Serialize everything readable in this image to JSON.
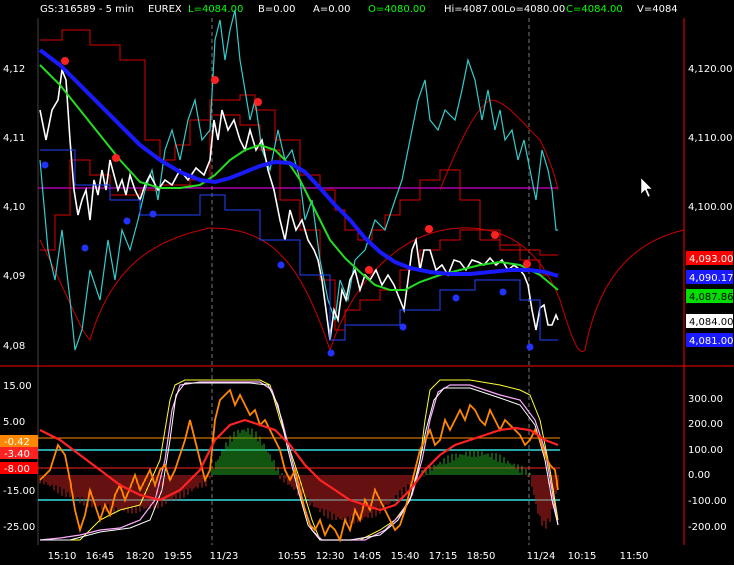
{
  "header": {
    "symbol": "GS:316589 - 5 min",
    "exchange": "EUREX",
    "last": "L=4084.00",
    "bid": "B=0.00",
    "ask": "A=0.00",
    "open": "O=4080.00",
    "high": "Hi=4087.00",
    "low": "Lo=4080.00",
    "close": "C=4084.00",
    "volume": "V=4084"
  },
  "price_tags": [
    {
      "label": "4,093.00",
      "bg": "#ff0000",
      "fg": "#ffffff"
    },
    {
      "label": "4,090.17",
      "bg": "#1a1aff",
      "fg": "#ffffff"
    },
    {
      "label": "4,087.86",
      "bg": "#00dd00",
      "fg": "#000000"
    },
    {
      "label": "4,084.00",
      "bg": "#ffffff",
      "fg": "#000000"
    },
    {
      "label": "4,081.00",
      "bg": "#1a1aff",
      "fg": "#ffffff"
    }
  ],
  "osc_tags": [
    {
      "label": "-0.42",
      "bg": "#ff8800",
      "fg": "#ffffff"
    },
    {
      "label": "-3.40",
      "bg": "#ff2222",
      "fg": "#ffffff"
    },
    {
      "label": "-8.00",
      "bg": "#ff0000",
      "fg": "#ffffff"
    }
  ],
  "chart_data": [
    {
      "type": "line",
      "title": "",
      "yticks_left": [
        "4,12",
        "4,11",
        "4,10",
        "4,09",
        "4,08"
      ],
      "yticks_right": [
        "4,120.00",
        "4,110.00",
        "4,100.00"
      ],
      "ylim": [
        4078,
        4128
      ],
      "xticks": [
        "15:10",
        "16:45",
        "18:20",
        "19:55",
        "11/23",
        "10:55",
        "12:30",
        "14:05",
        "15:40",
        "17:15",
        "18:50",
        "11/24",
        "10:15",
        "11:50"
      ],
      "series": [],
      "price_close": [
        4118,
        4122,
        4112,
        4108,
        4100,
        4098,
        4104,
        4102,
        4106,
        4104,
        4103,
        4104,
        4105,
        4106,
        4112,
        4110,
        4108,
        4104,
        4100,
        4096,
        4092,
        4088,
        4082,
        4086,
        4090,
        4092,
        4088,
        4088,
        4090,
        4092,
        4090,
        4088,
        4090,
        4093,
        4092,
        4090,
        4088,
        4084
      ],
      "ma_blue": [
        4121,
        4119,
        4115,
        4111,
        4107,
        4104,
        4103,
        4103,
        4104,
        4105,
        4106,
        4107,
        4107,
        4106,
        4104,
        4101,
        4098,
        4095,
        4093,
        4092,
        4091,
        4091,
        4091,
        4091,
        4091,
        4090
      ],
      "ma_green": [
        4120,
        4116,
        4110,
        4106,
        4104,
        4103,
        4104,
        4106,
        4108,
        4108,
        4106,
        4102,
        4098,
        4094,
        4091,
        4089,
        4088,
        4088,
        4089,
        4089,
        4088,
        4087
      ],
      "cyan_line": [
        4100,
        4090,
        4080,
        4086,
        4092,
        4098,
        4104,
        4108,
        4110,
        4106,
        4126,
        4120,
        4108,
        4100,
        4094,
        4090,
        4084,
        4080,
        4086,
        4098,
        4110,
        4116,
        4108,
        4114,
        4124,
        4112,
        4108,
        4104,
        4098,
        4096
      ],
      "horizontal_level": 4102.5,
      "dots_red": [
        [
          1,
          4121
        ],
        [
          5,
          4106
        ],
        [
          11,
          4116
        ],
        [
          13,
          4113
        ],
        [
          21,
          4089
        ],
        [
          24,
          4093
        ],
        [
          29,
          4092
        ],
        [
          32,
          4089
        ]
      ],
      "dots_blue": [
        [
          0,
          4105
        ],
        [
          2,
          4093
        ],
        [
          5,
          4099
        ],
        [
          7,
          4100
        ],
        [
          15,
          4091
        ],
        [
          20,
          4080
        ],
        [
          24,
          4085
        ],
        [
          27,
          4087
        ],
        [
          30,
          4088
        ],
        [
          32,
          4081
        ]
      ]
    },
    {
      "type": "line",
      "title": "",
      "yticks_left": [
        "15.00",
        "5.00",
        "-5.00",
        "-15.00",
        "-25.00"
      ],
      "yticks_right": [
        "300.00",
        "200.00",
        "100.00",
        "0.00",
        "-100.00",
        "-200.00"
      ],
      "ylim": [
        -250,
        400
      ],
      "levels": [
        100,
        -100
      ],
      "yellow_osc": [
        -200,
        -220,
        -150,
        -50,
        350,
        370,
        360,
        330,
        300,
        200,
        0,
        -100,
        -200,
        -220,
        -180,
        -100,
        0,
        100,
        350,
        370,
        330,
        320,
        200,
        0,
        -150,
        -200
      ],
      "orange_osc": [
        0,
        -50,
        -100,
        -50,
        0,
        200,
        250,
        150,
        150,
        100,
        0,
        -50,
        -100,
        -150,
        -100,
        -50,
        0,
        100,
        200,
        250,
        200,
        150,
        100,
        50,
        -50,
        -100
      ],
      "red_slow": [
        50,
        20,
        -50,
        -120,
        -100,
        0,
        100,
        150,
        180,
        160,
        100,
        20,
        -50,
        -100,
        -80,
        0,
        80,
        150,
        180,
        200,
        200,
        150,
        50,
        0,
        -50
      ]
    }
  ]
}
